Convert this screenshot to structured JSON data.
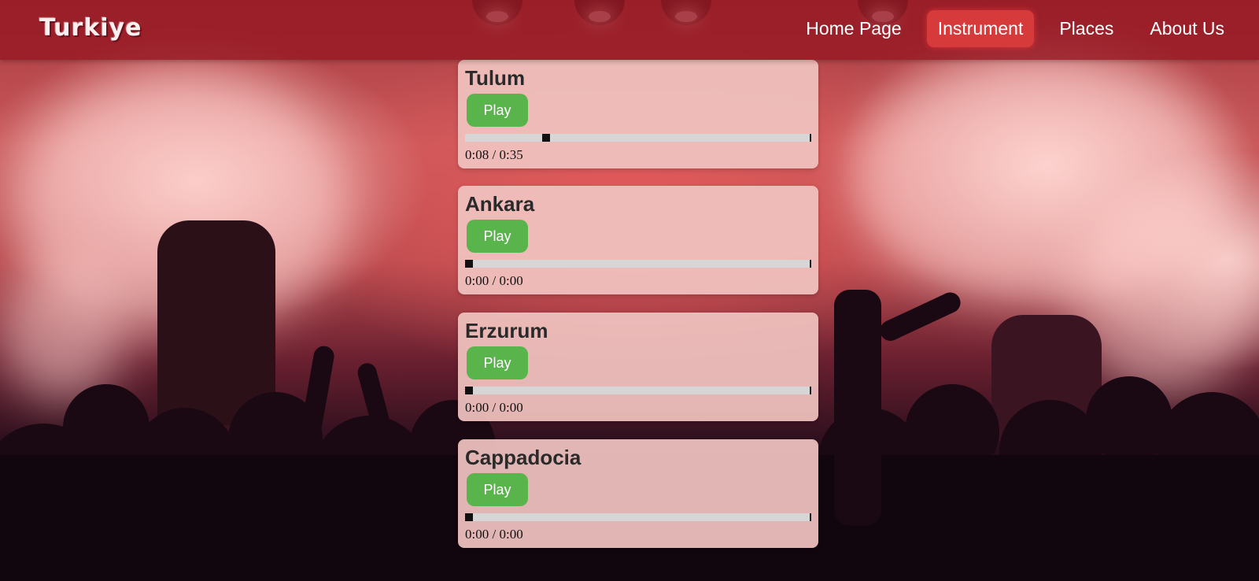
{
  "header": {
    "logo": "Turkiye",
    "nav": [
      {
        "label": "Home Page",
        "active": false
      },
      {
        "label": "Instrument",
        "active": true
      },
      {
        "label": "Places",
        "active": false
      },
      {
        "label": "About Us",
        "active": false
      }
    ]
  },
  "tracks": [
    {
      "title": "Tulum",
      "play_label": "Play",
      "current": "0:08",
      "separator": "/",
      "duration": "0:35",
      "progress": 0.229
    },
    {
      "title": "Ankara",
      "play_label": "Play",
      "current": "0:00",
      "separator": "/",
      "duration": "0:00",
      "progress": 0
    },
    {
      "title": "Erzurum",
      "play_label": "Play",
      "current": "0:00",
      "separator": "/",
      "duration": "0:00",
      "progress": 0
    },
    {
      "title": "Cappadocia",
      "play_label": "Play",
      "current": "0:00",
      "separator": "/",
      "duration": "0:00",
      "progress": 0
    }
  ],
  "colors": {
    "header_bg": "#96192399",
    "active_nav": "#d63a3a",
    "play_button": "#59b54b",
    "card_bg": "#f0c3c0",
    "progress_track": "#d6d6d6"
  },
  "icons": {
    "background": "concert-stage-photo"
  }
}
